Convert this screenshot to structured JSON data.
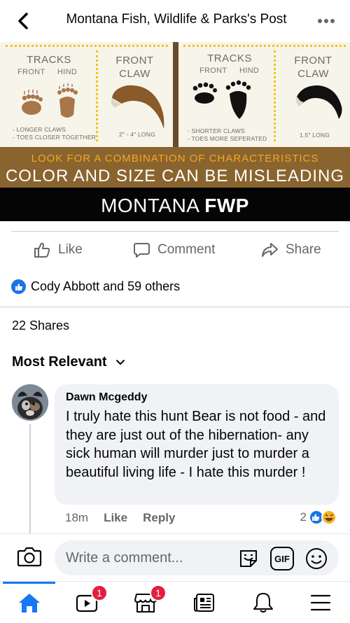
{
  "header": {
    "title": "Montana Fish, Wildlife & Parks's Post"
  },
  "infographic": {
    "left": {
      "tracks_label": "TRACKS",
      "front_label": "FRONT",
      "hind_label": "HIND",
      "claw_title": "FRONT CLAW",
      "note_line1": "- LONGER CLAWS",
      "note_line2": "- TOES CLOSER TOGETHER",
      "claw_length": "2\" - 4\" LONG"
    },
    "right": {
      "tracks_label": "TRACKS",
      "front_label": "FRONT",
      "hind_label": "HIND",
      "claw_title": "FRONT CLAW",
      "note_line1": "- SHORTER CLAWS",
      "note_line2": "- TOES MORE SEPERATED",
      "claw_length": "1.5\" LONG"
    },
    "band_line1": "LOOK FOR A COMBINATION OF CHARACTERISTICS",
    "band_line2": "COLOR AND SIZE CAN BE MISLEADING",
    "footer_light": "MONTANA ",
    "footer_bold": "FWP"
  },
  "actions": {
    "like": "Like",
    "comment": "Comment",
    "share": "Share"
  },
  "reactions": {
    "summary": "Cody Abbott and 59 others"
  },
  "shares": "22 Shares",
  "sort": {
    "label": "Most Relevant"
  },
  "comment": {
    "author": "Dawn Mcgeddy",
    "text": "I truly hate this hunt Bear is not food - and they are just out of the hibernation- any sick human will murder just to murder a beautiful living life - I hate this murder !",
    "time": "18m",
    "like": "Like",
    "reply": "Reply",
    "reaction_count": "2"
  },
  "composer": {
    "placeholder": "Write a comment...",
    "gif": "GIF"
  },
  "nav": {
    "watch_badge": "1",
    "marketplace_badge": "1"
  },
  "colors": {
    "accent": "#1877f2",
    "band_brown": "#8a642f",
    "band_text": "#f5a623",
    "badge": "#e41e3f"
  }
}
